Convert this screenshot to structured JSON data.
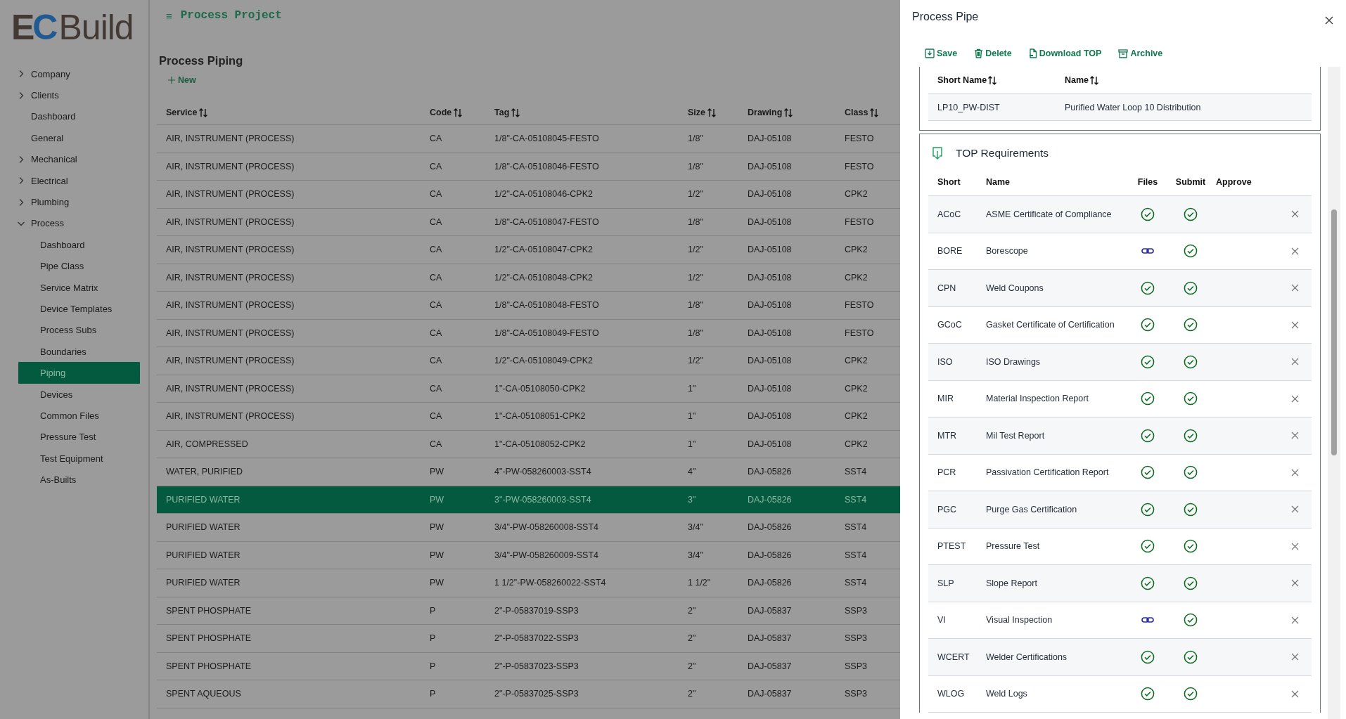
{
  "logo": {
    "mark": "EC",
    "name": "Build"
  },
  "sidebar": {
    "items": [
      {
        "label": "Company",
        "expanded": false,
        "selected": false
      },
      {
        "label": "Clients",
        "expanded": false,
        "selected": false
      },
      {
        "label": "Dashboard",
        "selected": false
      },
      {
        "label": "General",
        "selected": false
      },
      {
        "label": "Mechanical",
        "expanded": false,
        "selected": false
      },
      {
        "label": "Electrical",
        "expanded": false,
        "selected": false
      },
      {
        "label": "Plumbing",
        "expanded": false,
        "selected": false
      },
      {
        "label": "Process",
        "expanded": true,
        "selected": false,
        "children": [
          {
            "label": "Dashboard",
            "selected": false
          },
          {
            "label": "Pipe Class",
            "selected": false
          },
          {
            "label": "Service Matrix",
            "selected": false
          },
          {
            "label": "Device Templates",
            "selected": false
          },
          {
            "label": "Process Subs",
            "selected": false
          },
          {
            "label": "Boundaries",
            "selected": false
          },
          {
            "label": "Piping",
            "selected": true
          },
          {
            "label": "Devices",
            "selected": false
          },
          {
            "label": "Common Files",
            "selected": false
          },
          {
            "label": "Pressure Test",
            "selected": false
          },
          {
            "label": "Test Equipment",
            "selected": false
          },
          {
            "label": "As-Builts",
            "selected": false
          }
        ]
      }
    ]
  },
  "header": {
    "menu": "≡",
    "title": "Process Project"
  },
  "page": {
    "title": "Process Piping",
    "new_button": "New"
  },
  "table": {
    "columns": [
      "Service",
      "Code",
      "Tag",
      "Size",
      "Drawing",
      "Class"
    ],
    "rows": [
      {
        "cells": [
          "AIR, INSTRUMENT (PROCESS)",
          "CA",
          "1/8\"-CA-05108045-FESTO",
          "1/8\"",
          "DAJ-05108",
          "FESTO"
        ],
        "selected": false
      },
      {
        "cells": [
          "AIR, INSTRUMENT (PROCESS)",
          "CA",
          "1/8\"-CA-05108046-FESTO",
          "1/8\"",
          "DAJ-05108",
          "FESTO"
        ],
        "selected": false
      },
      {
        "cells": [
          "AIR, INSTRUMENT (PROCESS)",
          "CA",
          "1/2\"-CA-05108046-CPK2",
          "1/2\"",
          "DAJ-05108",
          "CPK2"
        ],
        "selected": false
      },
      {
        "cells": [
          "AIR, INSTRUMENT (PROCESS)",
          "CA",
          "1/8\"-CA-05108047-FESTO",
          "1/8\"",
          "DAJ-05108",
          "FESTO"
        ],
        "selected": false
      },
      {
        "cells": [
          "AIR, INSTRUMENT (PROCESS)",
          "CA",
          "1/2\"-CA-05108047-CPK2",
          "1/2\"",
          "DAJ-05108",
          "CPK2"
        ],
        "selected": false
      },
      {
        "cells": [
          "AIR, INSTRUMENT (PROCESS)",
          "CA",
          "1/2\"-CA-05108048-CPK2",
          "1/2\"",
          "DAJ-05108",
          "CPK2"
        ],
        "selected": false
      },
      {
        "cells": [
          "AIR, INSTRUMENT (PROCESS)",
          "CA",
          "1/8\"-CA-05108048-FESTO",
          "1/8\"",
          "DAJ-05108",
          "FESTO"
        ],
        "selected": false
      },
      {
        "cells": [
          "AIR, INSTRUMENT (PROCESS)",
          "CA",
          "1/8\"-CA-05108049-FESTO",
          "1/8\"",
          "DAJ-05108",
          "FESTO"
        ],
        "selected": false
      },
      {
        "cells": [
          "AIR, INSTRUMENT (PROCESS)",
          "CA",
          "1/2\"-CA-05108049-CPK2",
          "1/2\"",
          "DAJ-05108",
          "CPK2"
        ],
        "selected": false
      },
      {
        "cells": [
          "AIR, INSTRUMENT (PROCESS)",
          "CA",
          "1\"-CA-05108050-CPK2",
          "1\"",
          "DAJ-05108",
          "CPK2"
        ],
        "selected": false
      },
      {
        "cells": [
          "AIR, INSTRUMENT (PROCESS)",
          "CA",
          "1\"-CA-05108051-CPK2",
          "1\"",
          "DAJ-05108",
          "CPK2"
        ],
        "selected": false
      },
      {
        "cells": [
          "AIR, COMPRESSED",
          "CA",
          "1\"-CA-05108052-CPK2",
          "1\"",
          "DAJ-05108",
          "CPK2"
        ],
        "selected": false
      },
      {
        "cells": [
          "WATER, PURIFIED",
          "PW",
          "4\"-PW-058260003-SST4",
          "4\"",
          "DAJ-05826",
          "SST4"
        ],
        "selected": false
      },
      {
        "cells": [
          "PURIFIED WATER",
          "PW",
          "3\"-PW-058260003-SST4",
          "3\"",
          "DAJ-05826",
          "SST4"
        ],
        "selected": true
      },
      {
        "cells": [
          "PURIFIED WATER",
          "PW",
          "3/4\"-PW-058260008-SST4",
          "3/4\"",
          "DAJ-05826",
          "SST4"
        ],
        "selected": false
      },
      {
        "cells": [
          "PURIFIED WATER",
          "PW",
          "3/4\"-PW-058260009-SST4",
          "3/4\"",
          "DAJ-05826",
          "SST4"
        ],
        "selected": false
      },
      {
        "cells": [
          "PURIFIED WATER",
          "PW",
          "1 1/2\"-PW-058260022-SST4",
          "1 1/2\"",
          "DAJ-05826",
          "SST4"
        ],
        "selected": false
      },
      {
        "cells": [
          "SPENT PHOSPHATE",
          "P",
          "2\"-P-05837019-SSP3",
          "2\"",
          "DAJ-05837",
          "SSP3"
        ],
        "selected": false
      },
      {
        "cells": [
          "SPENT PHOSPHATE",
          "P",
          "2\"-P-05837022-SSP3",
          "2\"",
          "DAJ-05837",
          "SSP3"
        ],
        "selected": false
      },
      {
        "cells": [
          "SPENT PHOSPHATE",
          "P",
          "2\"-P-05837023-SSP3",
          "2\"",
          "DAJ-05837",
          "SSP3"
        ],
        "selected": false
      },
      {
        "cells": [
          "SPENT AQUEOUS",
          "P",
          "2\"-P-05837025-SSP3",
          "2\"",
          "DAJ-05837",
          "SSP3"
        ],
        "selected": false
      }
    ]
  },
  "panel": {
    "title": "Process Pipe",
    "toolbar": [
      {
        "kind": "save",
        "label": "Save"
      },
      {
        "kind": "delete",
        "label": "Delete"
      },
      {
        "kind": "pdf",
        "label": "Download TOP"
      },
      {
        "kind": "archive",
        "label": "Archive"
      }
    ],
    "loop_table": {
      "columns": [
        "Short Name",
        "Name"
      ],
      "rows": [
        [
          "LP10_PW-DIST",
          "Purified Water Loop 10 Distribution"
        ]
      ]
    },
    "requirements": {
      "title": "TOP Requirements",
      "columns": [
        "Short",
        "Name",
        "Files",
        "Submit",
        "Approve"
      ],
      "rows": [
        {
          "short": "ACoC",
          "name": "ASME Certificate of Compliance",
          "files_complete": true,
          "submitted": true
        },
        {
          "short": "BORE",
          "name": "Borescope",
          "files_complete": false,
          "submitted": true
        },
        {
          "short": "CPN",
          "name": "Weld Coupons",
          "files_complete": true,
          "submitted": true
        },
        {
          "short": "GCoC",
          "name": "Gasket Certificate of Certification",
          "files_complete": true,
          "submitted": true
        },
        {
          "short": "ISO",
          "name": "ISO Drawings",
          "files_complete": true,
          "submitted": true
        },
        {
          "short": "MIR",
          "name": "Material Inspection Report",
          "files_complete": true,
          "submitted": true
        },
        {
          "short": "MTR",
          "name": "Mil Test Report",
          "files_complete": true,
          "submitted": true
        },
        {
          "short": "PCR",
          "name": "Passivation Certification Report",
          "files_complete": true,
          "submitted": true
        },
        {
          "short": "PGC",
          "name": "Purge Gas Certification",
          "files_complete": true,
          "submitted": true
        },
        {
          "short": "PTEST",
          "name": "Pressure Test",
          "files_complete": true,
          "submitted": true
        },
        {
          "short": "SLP",
          "name": "Slope Report",
          "files_complete": true,
          "submitted": true
        },
        {
          "short": "VI",
          "name": "Visual Inspection",
          "files_complete": false,
          "submitted": true
        },
        {
          "short": "WCERT",
          "name": "Welder Certifications",
          "files_complete": true,
          "submitted": true
        },
        {
          "short": "WLOG",
          "name": "Weld Logs",
          "files_complete": true,
          "submitted": true
        }
      ]
    }
  }
}
